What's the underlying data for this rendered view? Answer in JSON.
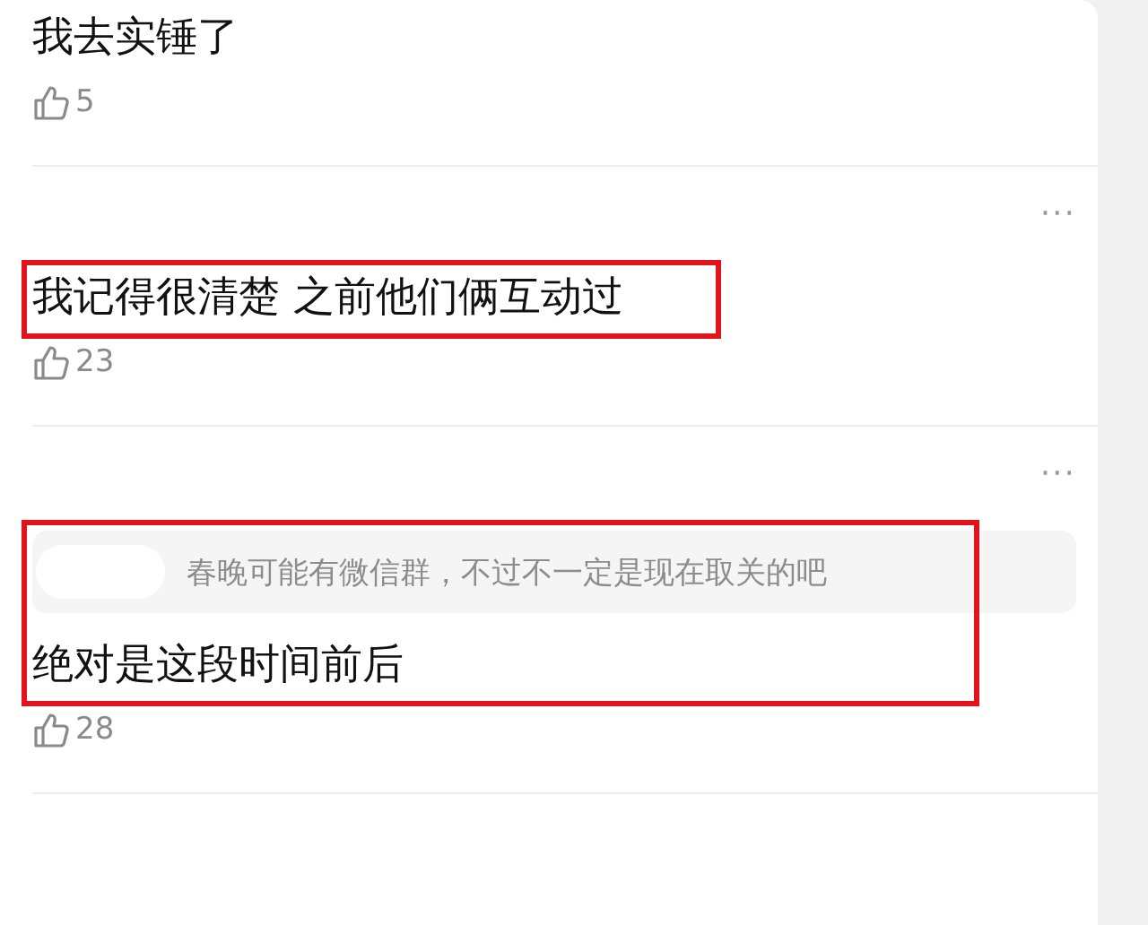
{
  "comments": [
    {
      "text": "我去实锤了",
      "likes": "5",
      "highlighted": false
    },
    {
      "menu_label": "···",
      "text": "我记得很清楚 之前他们俩互动过",
      "likes": "23",
      "highlighted": true
    },
    {
      "menu_label": "···",
      "quote": {
        "text": "春晚可能有微信群，不过不一定是现在取关的吧"
      },
      "text": "绝对是这段时间前后",
      "likes": "28",
      "highlighted": true
    }
  ]
}
